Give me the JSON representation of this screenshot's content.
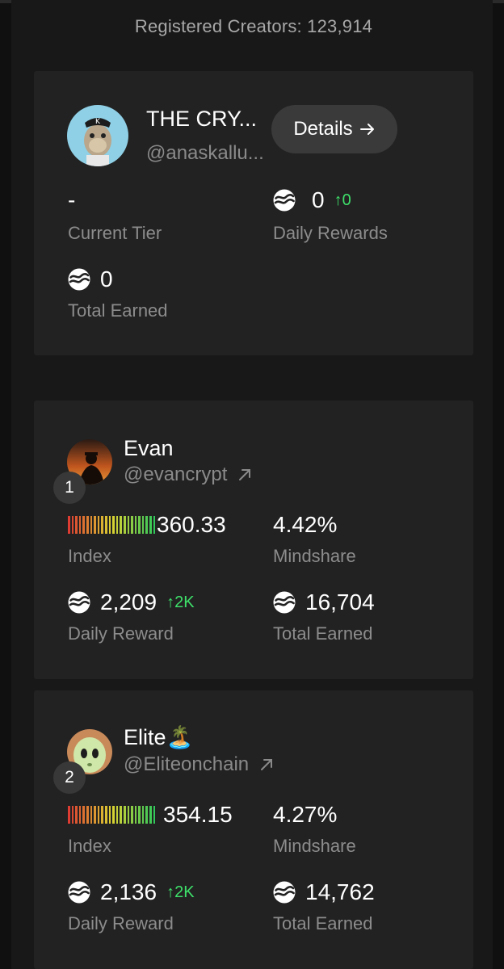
{
  "header": {
    "registered_creators": "Registered Creators: 123,914"
  },
  "my_card": {
    "name": "THE CRY...",
    "handle": "@anaskallu...",
    "details_label": "Details",
    "current_tier_value": "-",
    "current_tier_label": "Current Tier",
    "daily_rewards_value": "0",
    "daily_rewards_delta": "↑0",
    "daily_rewards_label": "Daily Rewards",
    "total_earned_value": "0",
    "total_earned_label": "Total Earned"
  },
  "leaderboard": [
    {
      "rank": "1",
      "name": "Evan",
      "handle": "@evancrypt",
      "index_value": "360.33",
      "index_label": "Index",
      "mindshare_value": "4.42%",
      "mindshare_label": "Mindshare",
      "daily_reward_value": "2,209",
      "daily_reward_delta": "↑2K",
      "daily_reward_label": "Daily Reward",
      "total_earned_value": "16,704",
      "total_earned_label": "Total Earned"
    },
    {
      "rank": "2",
      "name": "Elite🏝️",
      "handle": "@Eliteonchain",
      "index_value": "354.15",
      "index_label": "Index",
      "mindshare_value": "4.27%",
      "mindshare_label": "Mindshare",
      "daily_reward_value": "2,136",
      "daily_reward_delta": "↑2K",
      "daily_reward_label": "Daily Reward",
      "total_earned_value": "14,762",
      "total_earned_label": "Total Earned"
    }
  ],
  "colors": {
    "positive_delta": "#3ee06a",
    "card_bg": "#222222",
    "page_bg": "#101010"
  }
}
